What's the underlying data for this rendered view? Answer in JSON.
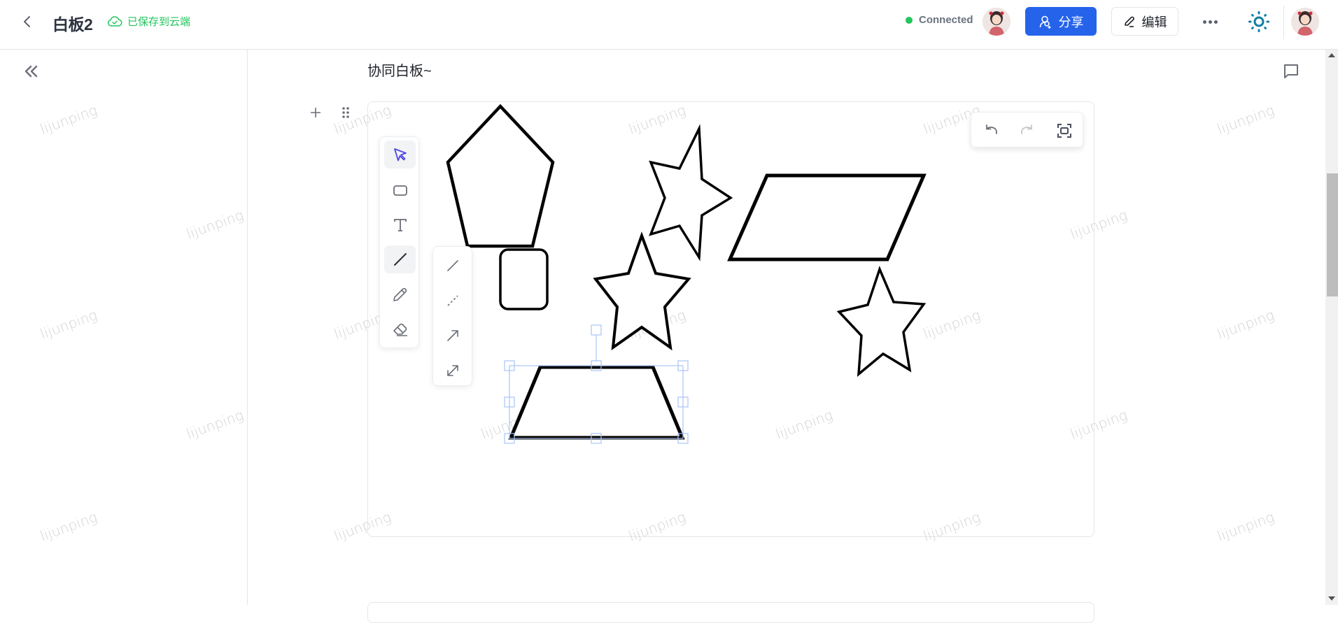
{
  "header": {
    "back_icon": "chevron-left-icon",
    "title": "白板2",
    "save_status": "已保存到云端",
    "save_icon": "cloud-check-icon",
    "connection_status": "Connected",
    "share_label": "分享",
    "edit_label": "编辑",
    "more_icon": "more-horizontal-icon",
    "theme_icon": "sun-icon"
  },
  "colors": {
    "accent": "#2563eb",
    "success": "#22c55e",
    "theme_icon": "#0e7fa5",
    "active_tool": "#4f46e5",
    "selection": "#7aa5f5"
  },
  "sidebar": {
    "collapse_icon": "chevrons-left-icon"
  },
  "page": {
    "heading": "协同白板~",
    "comment_icon": "comment-icon"
  },
  "whiteboard": {
    "toolbar": [
      {
        "name": "select",
        "icon": "cursor-icon",
        "active": true
      },
      {
        "name": "rectangle",
        "icon": "rectangle-icon",
        "active": false
      },
      {
        "name": "text",
        "icon": "text-icon",
        "active": false
      },
      {
        "name": "line",
        "icon": "line-icon",
        "active": true
      },
      {
        "name": "pencil",
        "icon": "pencil-icon",
        "active": false
      },
      {
        "name": "eraser",
        "icon": "eraser-icon",
        "active": false
      }
    ],
    "line_submenu": [
      {
        "name": "straight-line",
        "icon": "line-icon"
      },
      {
        "name": "dashed-line",
        "icon": "dashed-line-icon"
      },
      {
        "name": "arrow-line",
        "icon": "arrow-icon"
      },
      {
        "name": "double-arrow-line",
        "icon": "double-arrow-icon"
      }
    ],
    "history": [
      {
        "name": "undo",
        "icon": "undo-icon",
        "enabled": true
      },
      {
        "name": "redo",
        "icon": "redo-icon",
        "enabled": false
      },
      {
        "name": "fit-view",
        "icon": "fit-screen-icon",
        "enabled": true
      }
    ],
    "shapes": [
      {
        "type": "pentagon"
      },
      {
        "type": "star"
      },
      {
        "type": "parallelogram"
      },
      {
        "type": "rounded-rectangle"
      },
      {
        "type": "star"
      },
      {
        "type": "star"
      },
      {
        "type": "trapezoid",
        "selected": true
      }
    ]
  },
  "watermark_text": "lijunping"
}
